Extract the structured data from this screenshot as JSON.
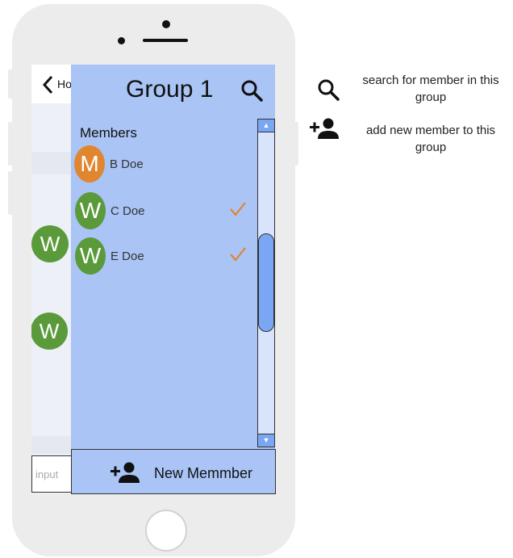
{
  "background_screen": {
    "back_label": "Ho",
    "avatars": [
      {
        "letter": "W",
        "color": "#5b9a3b"
      },
      {
        "letter": "W",
        "color": "#5b9a3b"
      }
    ],
    "input": {
      "placeholder": "input",
      "value": ""
    }
  },
  "drawer": {
    "title": "Group 1",
    "search_icon": "search-icon",
    "members_heading": "Members",
    "members": [
      {
        "avatar_letter": "M",
        "avatar_color": "#e0862f",
        "name": "B Doe",
        "selected": false
      },
      {
        "avatar_letter": "W",
        "avatar_color": "#5b9a3b",
        "name": "C Doe",
        "selected": true
      },
      {
        "avatar_letter": "W",
        "avatar_color": "#5b9a3b",
        "name": "E Doe",
        "selected": true
      }
    ],
    "check_color": "#e0862f",
    "new_member_button": {
      "label": "New Memmber",
      "icon": "person-add-icon"
    }
  },
  "legend": [
    {
      "icon": "search-icon",
      "text": "search  for member in this group"
    },
    {
      "icon": "person-add-icon",
      "text": "add new member to this group"
    }
  ],
  "colors": {
    "drawer_bg": "#a9c4f5",
    "scroll_thumb": "#7aa7f3",
    "phone_body": "#ececec"
  }
}
